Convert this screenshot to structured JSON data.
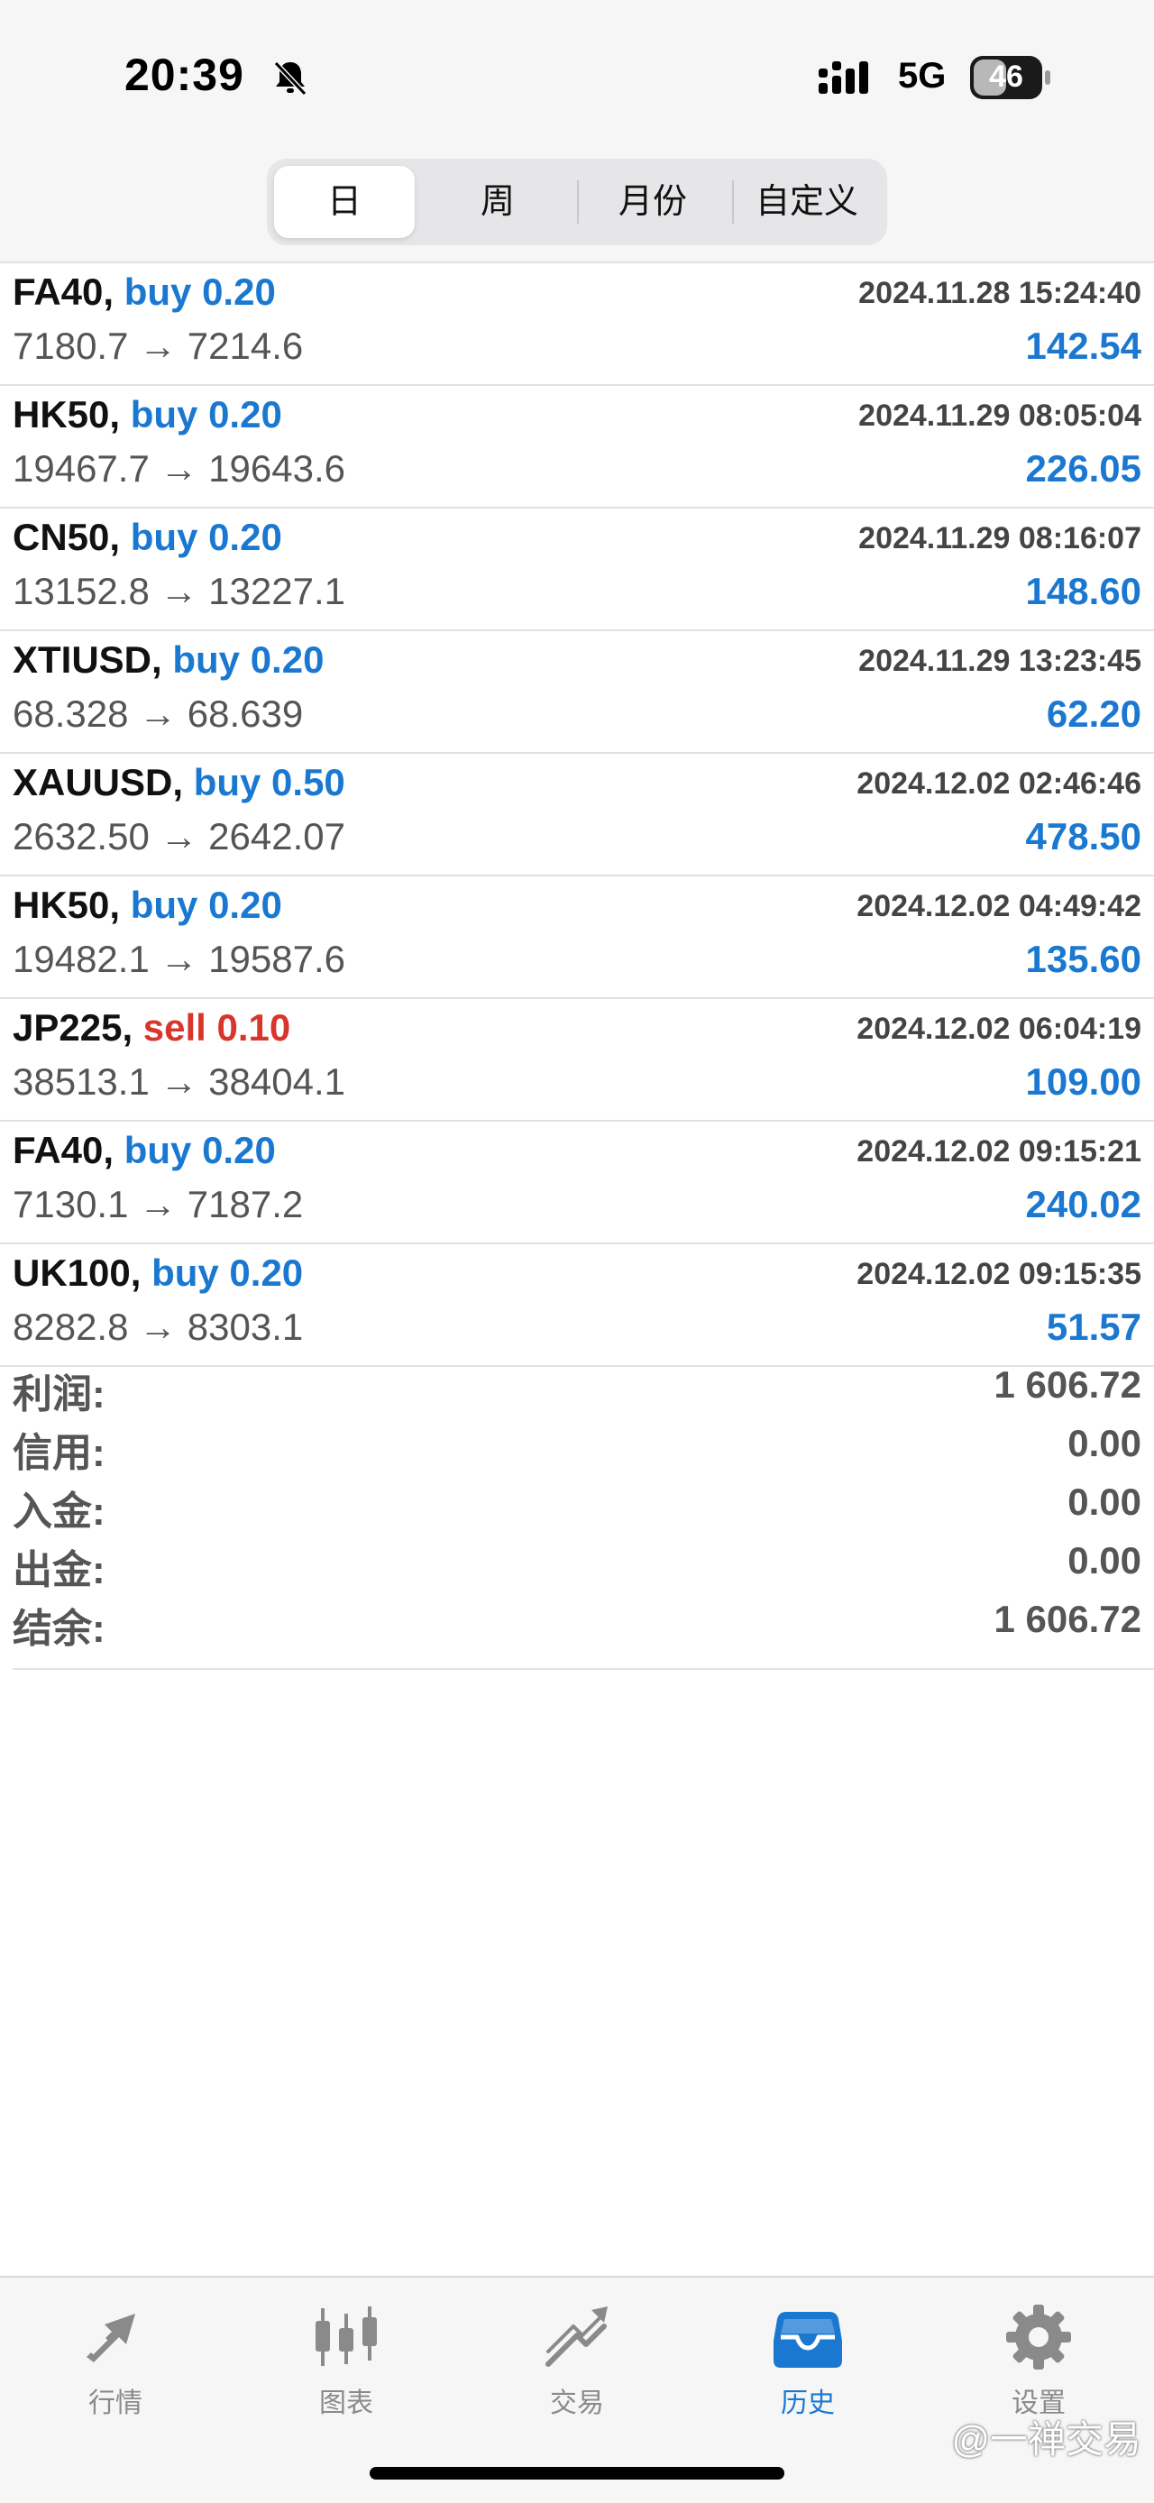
{
  "status_bar": {
    "time": "20:39",
    "network": "5G",
    "battery": "46"
  },
  "period_tabs": [
    {
      "label": "日",
      "active": true
    },
    {
      "label": "周",
      "active": false
    },
    {
      "label": "月份",
      "active": false
    },
    {
      "label": "自定义",
      "active": false
    }
  ],
  "deals": [
    {
      "symbol": "FA40,",
      "side": "buy 0.20",
      "type": "buy",
      "time": "2024.11.28 15:24:40",
      "prices": "7180.7 → 7214.6",
      "profit": "142.54"
    },
    {
      "symbol": "HK50,",
      "side": "buy 0.20",
      "type": "buy",
      "time": "2024.11.29 08:05:04",
      "prices": "19467.7 → 19643.6",
      "profit": "226.05"
    },
    {
      "symbol": "CN50,",
      "side": "buy 0.20",
      "type": "buy",
      "time": "2024.11.29 08:16:07",
      "prices": "13152.8 → 13227.1",
      "profit": "148.60"
    },
    {
      "symbol": "XTIUSD,",
      "side": "buy 0.20",
      "type": "buy",
      "time": "2024.11.29 13:23:45",
      "prices": "68.328 → 68.639",
      "profit": "62.20"
    },
    {
      "symbol": "XAUUSD,",
      "side": "buy 0.50",
      "type": "buy",
      "time": "2024.12.02 02:46:46",
      "prices": "2632.50 → 2642.07",
      "profit": "478.50"
    },
    {
      "symbol": "HK50,",
      "side": "buy 0.20",
      "type": "buy",
      "time": "2024.12.02 04:49:42",
      "prices": "19482.1 → 19587.6",
      "profit": "135.60"
    },
    {
      "symbol": "JP225,",
      "side": "sell 0.10",
      "type": "sell",
      "time": "2024.12.02 06:04:19",
      "prices": "38513.1 → 38404.1",
      "profit": "109.00"
    },
    {
      "symbol": "FA40,",
      "side": "buy 0.20",
      "type": "buy",
      "time": "2024.12.02 09:15:21",
      "prices": "7130.1 → 7187.2",
      "profit": "240.02"
    },
    {
      "symbol": "UK100,",
      "side": "buy 0.20",
      "type": "buy",
      "time": "2024.12.02 09:15:35",
      "prices": "8282.8 → 8303.1",
      "profit": "51.57"
    }
  ],
  "summary": [
    {
      "label": "利润:",
      "value": "1 606.72"
    },
    {
      "label": "信用:",
      "value": "0.00"
    },
    {
      "label": "入金:",
      "value": "0.00"
    },
    {
      "label": "出金:",
      "value": "0.00"
    },
    {
      "label": "结余:",
      "value": "1 606.72"
    }
  ],
  "tabbar": [
    {
      "label": "行情",
      "icon": "quotes-icon",
      "active": false
    },
    {
      "label": "图表",
      "icon": "chart-icon",
      "active": false
    },
    {
      "label": "交易",
      "icon": "trade-icon",
      "active": false
    },
    {
      "label": "历史",
      "icon": "history-icon",
      "active": true
    },
    {
      "label": "设置",
      "icon": "settings-icon",
      "active": false
    }
  ],
  "watermark": "@一禅交易",
  "colors": {
    "accent": "#1b78d0",
    "sell": "#d8352b"
  }
}
